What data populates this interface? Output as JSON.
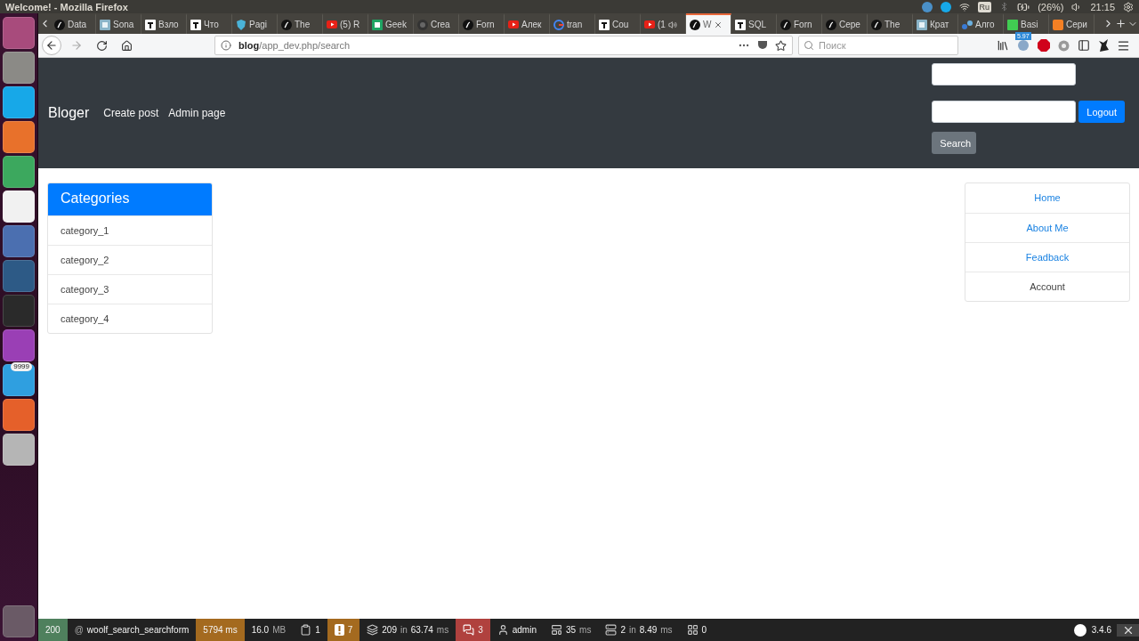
{
  "system_bar": {
    "title": "Welcome! - Mozilla Firefox",
    "keyboard": "Ru",
    "battery": "(26%)",
    "clock": "21:15"
  },
  "launcher": {
    "badge": "9999"
  },
  "tabs": [
    {
      "label": "Data",
      "kind": "symfony",
      "selected": false,
      "audio": false
    },
    {
      "label": "Sona",
      "kind": "square-blue",
      "selected": false,
      "audio": false
    },
    {
      "label": "Взло",
      "kind": "square-dark",
      "selected": false,
      "audio": false
    },
    {
      "label": "Что",
      "kind": "square-dark",
      "selected": false,
      "audio": false
    },
    {
      "label": "Pagi",
      "kind": "shield",
      "selected": false,
      "audio": false
    },
    {
      "label": "The",
      "kind": "symfony",
      "selected": false,
      "audio": false
    },
    {
      "label": "(5) R",
      "kind": "video",
      "selected": false,
      "audio": false
    },
    {
      "label": "Geek",
      "kind": "sheet",
      "selected": false,
      "audio": false
    },
    {
      "label": "Crea",
      "kind": "cat",
      "selected": false,
      "audio": false
    },
    {
      "label": "Forn",
      "kind": "symfony",
      "selected": false,
      "audio": false
    },
    {
      "label": "Алек",
      "kind": "video",
      "selected": false,
      "audio": false
    },
    {
      "label": "tran",
      "kind": "circle",
      "selected": false,
      "audio": false
    },
    {
      "label": "Cou",
      "kind": "square-dark",
      "selected": false,
      "audio": false
    },
    {
      "label": "(1",
      "kind": "video",
      "selected": false,
      "audio": true
    },
    {
      "label": "W",
      "kind": "symfony",
      "selected": true,
      "audio": false
    },
    {
      "label": "SQL",
      "kind": "square-dark",
      "selected": false,
      "audio": false
    },
    {
      "label": "Forn",
      "kind": "symfony",
      "selected": false,
      "audio": false
    },
    {
      "label": "Сере",
      "kind": "symfony",
      "selected": false,
      "audio": false
    },
    {
      "label": "The",
      "kind": "symfony",
      "selected": false,
      "audio": false
    },
    {
      "label": "Крат",
      "kind": "square-blue",
      "selected": false,
      "audio": false
    },
    {
      "label": "Алго",
      "kind": "nodes",
      "selected": false,
      "audio": false
    },
    {
      "label": "Basi",
      "kind": "square-green",
      "selected": false,
      "audio": false
    },
    {
      "label": "Сери",
      "kind": "square-orange",
      "selected": false,
      "audio": false
    }
  ],
  "address_bar": {
    "url": "**blog**/app_dev.php/search",
    "search_placeholder": "Поиск",
    "extension_badge": "5.97"
  },
  "site_nav": {
    "brand": "Bloger",
    "links": [
      "Create post",
      "Admin page"
    ],
    "logout": "Logout",
    "search": "Search"
  },
  "categories": {
    "title": "Categories",
    "items": [
      "category_1",
      "category_2",
      "category_3",
      "category_4"
    ]
  },
  "menu": [
    {
      "label": "Home",
      "kind": "link"
    },
    {
      "label": "About Me",
      "kind": "link"
    },
    {
      "label": "Feadback",
      "kind": "link"
    },
    {
      "label": "Account",
      "kind": "text"
    }
  ],
  "debug_bar": {
    "items": [
      {
        "kind": "plain",
        "color": "#4f805d",
        "parts": [
          {
            "text": "200",
            "muted": false
          }
        ]
      },
      {
        "kind": "plain",
        "parts": [
          {
            "text": "@",
            "muted": true
          },
          {
            "text": "woolf_search_searchform",
            "muted": false
          }
        ]
      },
      {
        "kind": "plain",
        "color": "#a46a1f",
        "parts": [
          {
            "text": "5794 ms",
            "muted": false
          }
        ]
      },
      {
        "kind": "plain",
        "parts": [
          {
            "text": "16.0",
            "muted": false
          },
          {
            "text": "MB",
            "muted": true
          }
        ]
      },
      {
        "kind": "clipboard",
        "parts": [
          {
            "text": "1",
            "muted": false
          }
        ]
      },
      {
        "kind": "warning",
        "color": "#a46a1f",
        "parts": [
          {
            "text": "7",
            "muted": false
          }
        ]
      },
      {
        "kind": "layers",
        "parts": [
          {
            "text": "209",
            "muted": false
          },
          {
            "text": "in",
            "muted": true
          },
          {
            "text": "63.74",
            "muted": false
          },
          {
            "text": "ms",
            "muted": true
          }
        ]
      },
      {
        "kind": "messages",
        "color": "#b0413e",
        "parts": [
          {
            "text": "3",
            "muted": false
          }
        ]
      },
      {
        "kind": "user",
        "parts": [
          {
            "text": "admin",
            "muted": false
          }
        ]
      },
      {
        "kind": "template",
        "parts": [
          {
            "text": "35",
            "muted": false
          },
          {
            "text": "ms",
            "muted": true
          }
        ]
      },
      {
        "kind": "database",
        "parts": [
          {
            "text": "2",
            "muted": false
          },
          {
            "text": "in",
            "muted": true
          },
          {
            "text": "8.49",
            "muted": false
          },
          {
            "text": "ms",
            "muted": true
          }
        ]
      },
      {
        "kind": "grid",
        "parts": [
          {
            "text": "0",
            "muted": false
          }
        ]
      }
    ],
    "version": "3.4.6"
  }
}
